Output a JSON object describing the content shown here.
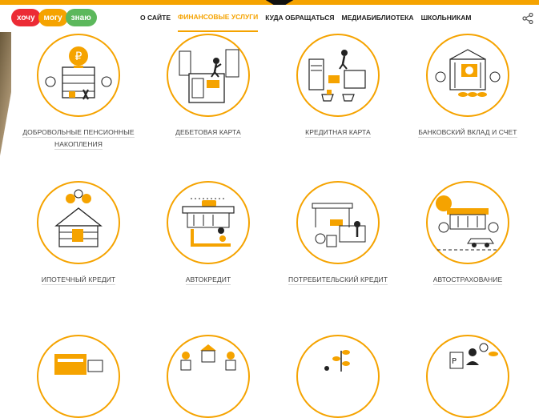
{
  "logo": {
    "part1": "хочу",
    "part2": "могу",
    "part3": "знаю"
  },
  "nav": [
    {
      "label": "О САЙТЕ",
      "active": false
    },
    {
      "label": "ФИНАНСОВЫЕ УСЛУГИ",
      "active": true
    },
    {
      "label": "КУДА ОБРАЩАТЬСЯ",
      "active": false
    },
    {
      "label": "МЕДИАБИБЛИОТЕКА",
      "active": false
    },
    {
      "label": "ШКОЛЬНИКАМ",
      "active": false
    }
  ],
  "colors": {
    "accent": "#f5a300",
    "text": "#222222",
    "muted": "#444444"
  },
  "tiles": [
    {
      "label": "ДОБРОВОЛЬНЫЕ ПЕНСИОННЫЕ НАКОПЛЕНИЯ",
      "icon": "pension-building-icon"
    },
    {
      "label": "ДЕБЕТОВАЯ КАРТА",
      "icon": "debit-card-atm-icon"
    },
    {
      "label": "КРЕДИТНАЯ КАРТА",
      "icon": "credit-card-shopping-icon"
    },
    {
      "label": "БАНКОВСКИЙ ВКЛАД И СЧЕТ",
      "icon": "bank-deposit-icon"
    },
    {
      "label": "ИПОТЕЧНЫЙ КРЕДИТ",
      "icon": "mortgage-house-icon"
    },
    {
      "label": "АВТОКРЕДИТ",
      "icon": "car-loan-icon"
    },
    {
      "label": "ПОТРЕБИТЕЛЬСКИЙ КРЕДИТ",
      "icon": "consumer-loan-icon"
    },
    {
      "label": "АВТОСТРАХОВАНИЕ",
      "icon": "car-insurance-icon"
    },
    {
      "label": "",
      "icon": "payments-card-icon"
    },
    {
      "label": "",
      "icon": "housing-icon"
    },
    {
      "label": "",
      "icon": "investment-plant-icon"
    },
    {
      "label": "",
      "icon": "consultant-icon"
    }
  ]
}
